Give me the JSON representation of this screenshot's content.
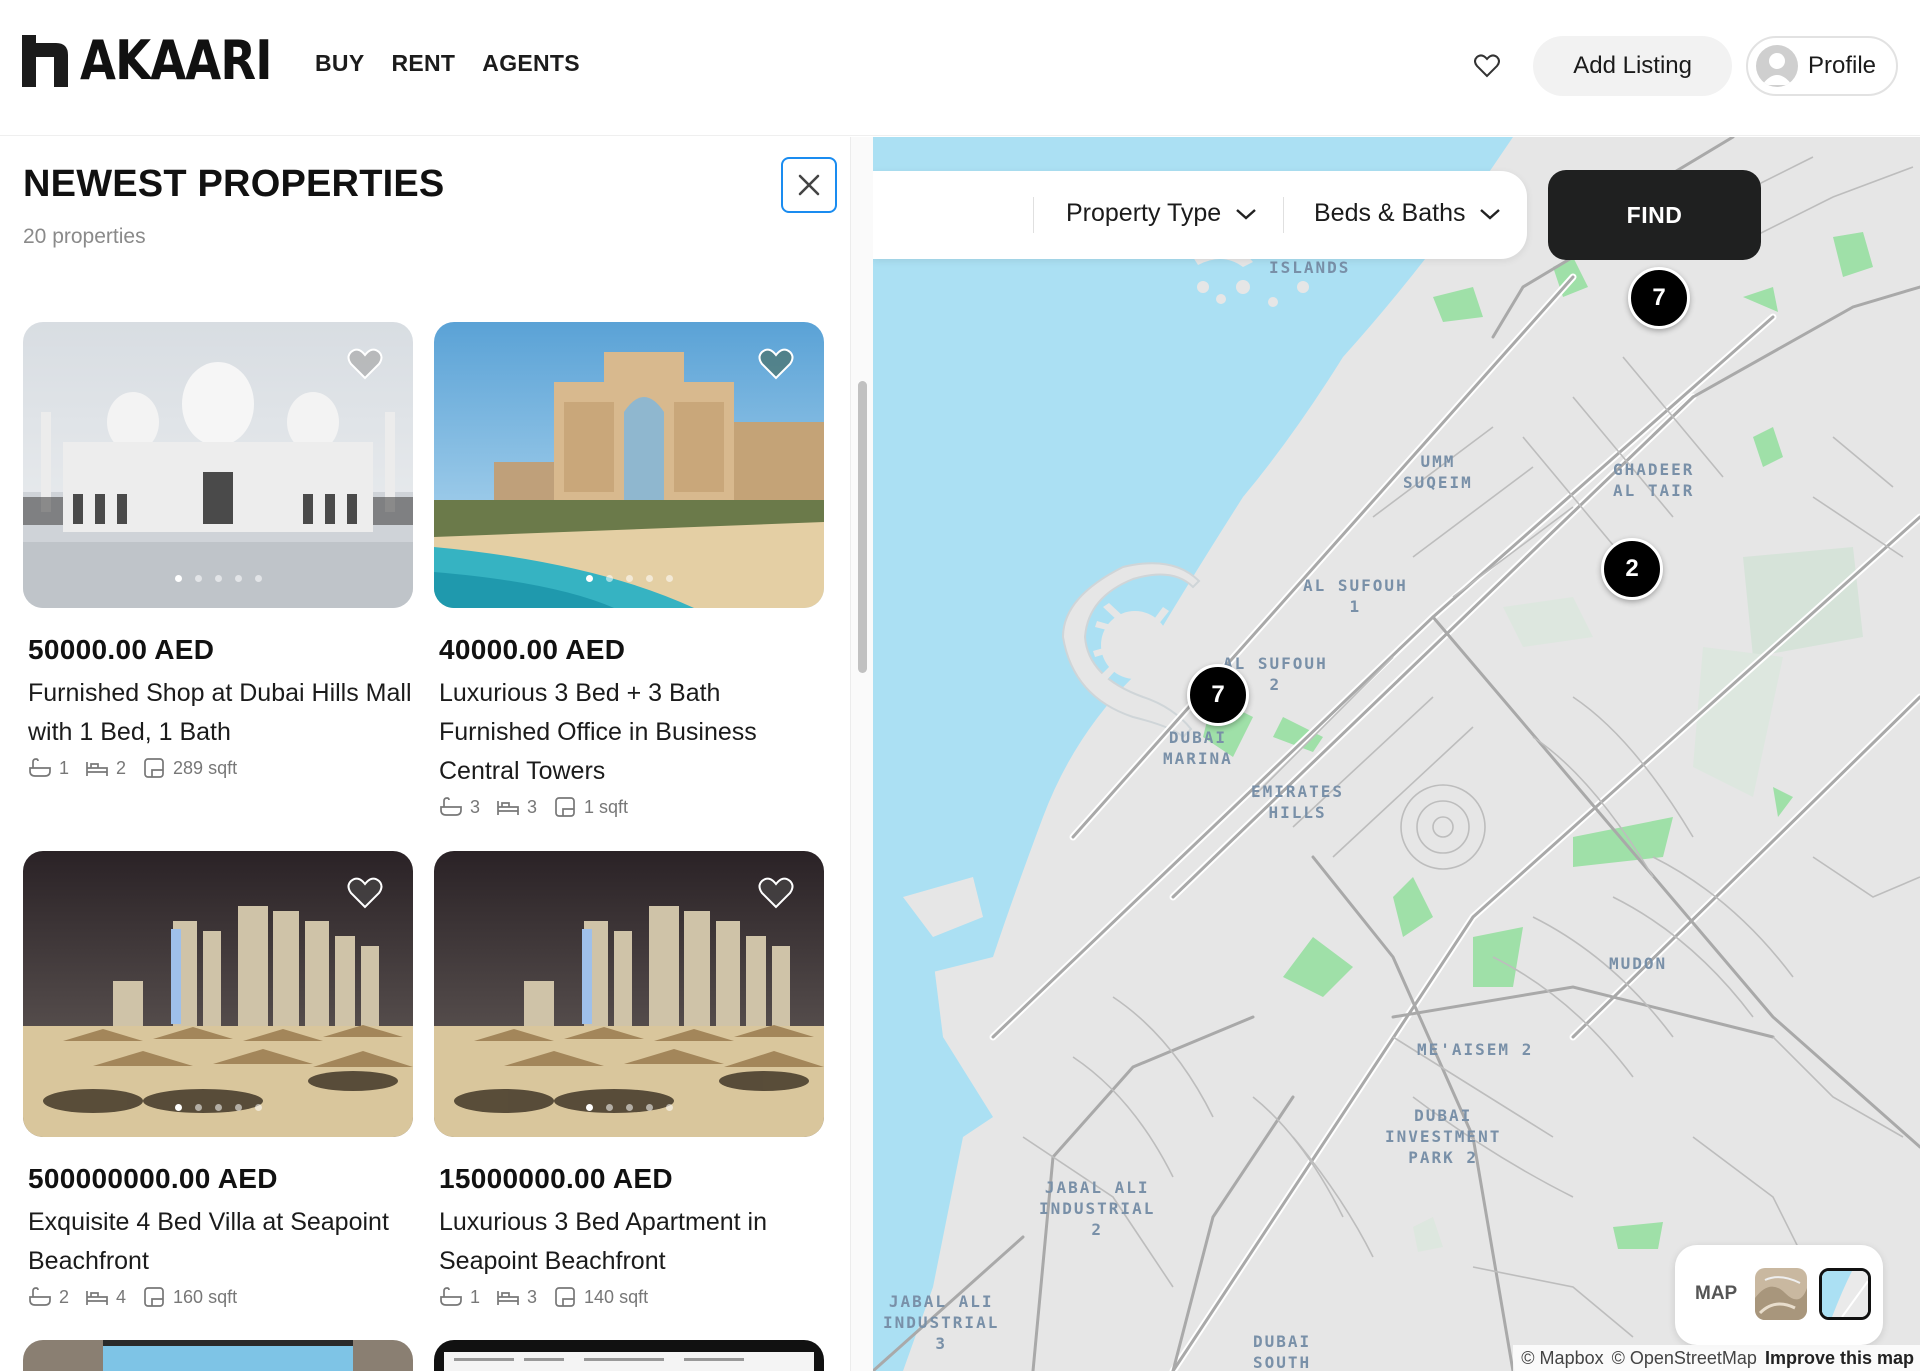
{
  "header": {
    "logo_text": "AKAARI",
    "nav": [
      "BUY",
      "RENT",
      "AGENTS"
    ],
    "add_listing": "Add Listing",
    "profile": "Profile"
  },
  "panel": {
    "title": "NEWEST PROPERTIES",
    "count": "20 properties"
  },
  "listings": [
    {
      "price": "50000.00 AED",
      "title": "Furnished Shop at Dubai Hills Mall with 1 Bed, 1 Bath",
      "baths": "1",
      "beds": "2",
      "area": "289 sqft",
      "image": "mosque"
    },
    {
      "price": "40000.00 AED",
      "title": "Luxurious 3 Bed + 3 Bath Furnished Office in Business Central Towers",
      "baths": "3",
      "beds": "3",
      "area": "1 sqft",
      "image": "atlantis"
    },
    {
      "price": "500000000.00 AED",
      "title": "Exquisite 4 Bed Villa at Seapoint Beachfront",
      "baths": "2",
      "beds": "4",
      "area": "160 sqft",
      "image": "beach-night"
    },
    {
      "price": "15000000.00 AED",
      "title": "Luxurious 3 Bed Apartment in Seapoint Beachfront",
      "baths": "1",
      "beds": "3",
      "area": "140 sqft",
      "image": "beach-night"
    }
  ],
  "filters": {
    "property_type": "Property Type",
    "beds_baths": "Beds & Baths",
    "find": "FIND"
  },
  "map": {
    "labels": {
      "islands": "ISLANDS",
      "umm_suqeim": "UMM\nSUQEIM",
      "ghadeer": "GHADEER\nAL TAIR",
      "al_sufouh_1": "AL SUFOUH\n1",
      "al_sufouh_2": "AL SUFOUH\n2",
      "dubai_marina": "DUBAI\nMARINA",
      "emirates_hills": "EMIRATES\nHILLS",
      "mudon": "MUDON",
      "meaisem": "ME'AISEM 2",
      "dip2": "DUBAI\nINVESTMENT\nPARK 2",
      "jai2": "JABAL ALI\nINDUSTRIAL\n2",
      "jai3": "JABAL ALI\nINDUSTRIAL\n3",
      "dubai_south": "DUBAI\nSOUTH"
    },
    "clusters": [
      "7",
      "2",
      "7"
    ],
    "style_label": "MAP",
    "attribution": {
      "mapbox": "© Mapbox",
      "osm": "© OpenStreetMap",
      "improve": "Improve this map"
    }
  },
  "colors": {
    "water": "#abe0f3",
    "land": "#e6e6e6",
    "park": "#9fe0a8",
    "accent_blue": "#1a8cf0"
  }
}
